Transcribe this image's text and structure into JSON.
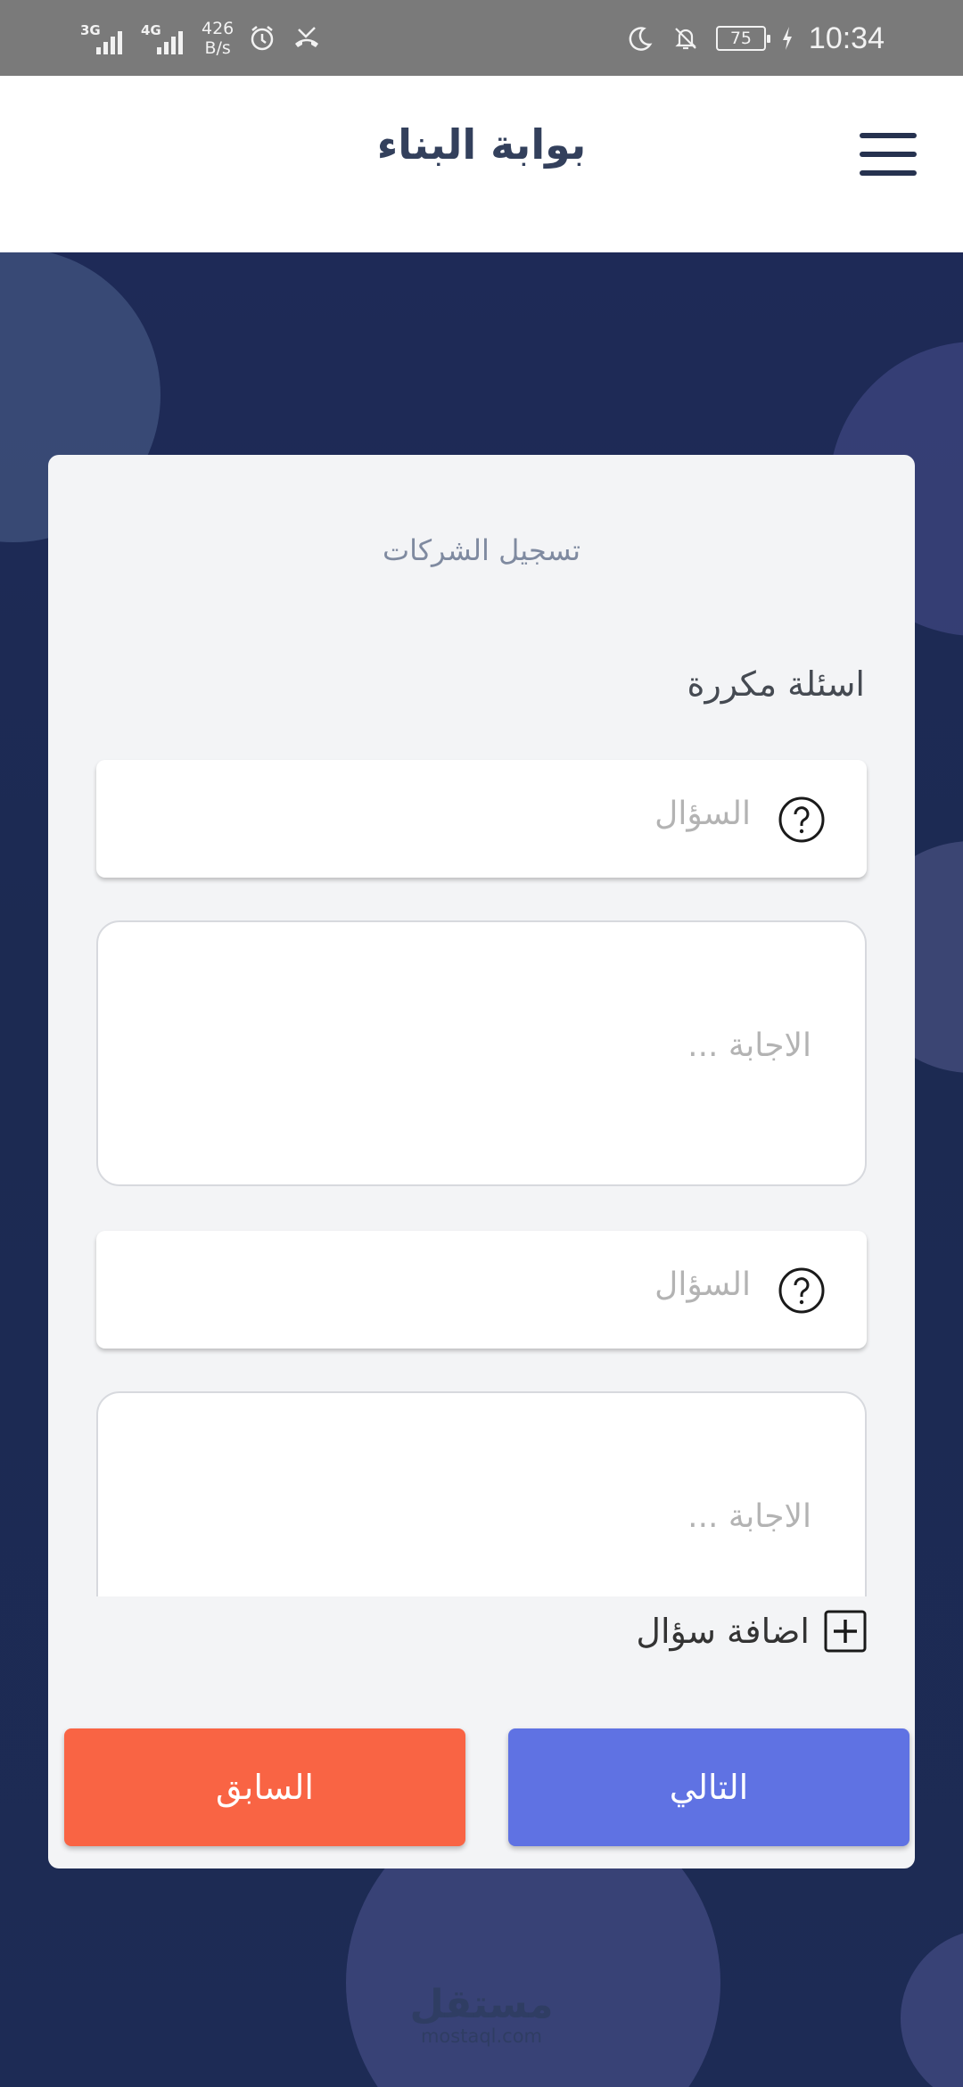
{
  "status_bar": {
    "sim1_tech": "3G",
    "sim2_tech": "4G",
    "speed_value": "426",
    "speed_unit": "B/s",
    "battery": "75",
    "time": "10:34",
    "icons": [
      "alarm-icon",
      "missed-call-icon",
      "moon-icon",
      "bell-off-icon",
      "charging-icon"
    ]
  },
  "app_bar": {
    "title": "بوابة البناء",
    "menu_icon": "hamburger-menu-icon"
  },
  "card": {
    "title": "تسجيل الشركات",
    "section_title": "اسئلة مكررة",
    "faq": [
      {
        "question_placeholder": "السؤال",
        "answer_placeholder": "الاجابة ..."
      },
      {
        "question_placeholder": "السؤال",
        "answer_placeholder": "الاجابة ..."
      }
    ],
    "add_question_label": "اضافة سؤال",
    "add_icon": "plus-box-icon",
    "prev_button": "السابق",
    "next_button": "التالي"
  },
  "watermark": {
    "arabic": "مستقل",
    "latin": "mostaql.com"
  },
  "colors": {
    "status_bar": "#7a7a7a",
    "background": "#1d2850",
    "card": "#f3f4f6",
    "prev_button": "#f96444",
    "next_button": "#5f72e3",
    "title_text": "#33405c"
  }
}
